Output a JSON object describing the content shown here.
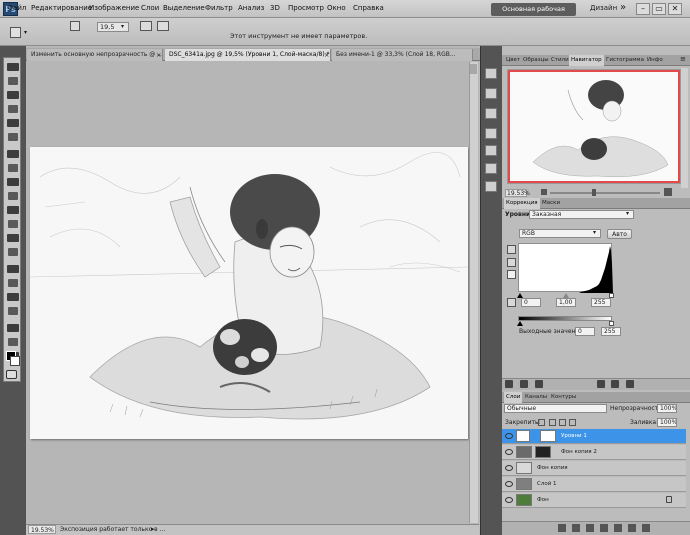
{
  "app": {
    "logo": "Ps"
  },
  "menu": [
    "Файл",
    "Редактирование",
    "Изображение",
    "Слои",
    "Выделение",
    "Фильтр",
    "Анализ",
    "3D",
    "Просмотр",
    "Окно",
    "Справка"
  ],
  "menubar_extras": {
    "zoom": "19,5",
    "zoom_arrow": "▾"
  },
  "workspace": {
    "active": "Основная рабочая среда",
    "design": "Дизайн",
    "more": "»"
  },
  "window_buttons": [
    "–",
    "▭",
    "✕"
  ],
  "options_bar": {
    "hint": "Этот инструмент не имеет параметров."
  },
  "doc_tabs": [
    {
      "label": "Изменить основную непрозрачность @ ...",
      "active": false
    },
    {
      "label": "DSC_6341a.jpg @ 19,5% (Уровни 1, Слой-маска/8) *",
      "active": true
    },
    {
      "label": "Без имени-1 @ 33,3% (Слой 18, RGB...",
      "active": false
    }
  ],
  "status": {
    "zoom": "19.53%",
    "text": "Экспозиция работает только в ...",
    "arrow": "▸"
  },
  "navigator": {
    "tabs": [
      "Цвет",
      "Образцы",
      "Стили",
      "Навигатор",
      "Гистограмма",
      "Инфо"
    ],
    "active_tab": "Навигатор",
    "zoom": "19.53%"
  },
  "corrections": {
    "tabs": [
      "Коррекция",
      "Маски"
    ],
    "levels_label": "Уровни",
    "preset": "Заказная",
    "channel": "RGB",
    "auto_button": "Авто",
    "input_black": "0",
    "input_gamma": "1,00",
    "input_white": "255",
    "output_label": "Выходные значения:",
    "output_black": "0",
    "output_white": "255"
  },
  "layers": {
    "tabs": [
      "Слои",
      "Каналы",
      "Контуры"
    ],
    "blend_mode": "Обычные",
    "opacity_label": "Непрозрачность:",
    "opacity": "100%",
    "lock_label": "Закрепить:",
    "fill_label": "Заливка:",
    "fill": "100%",
    "rows": [
      {
        "name": "Уровни 1",
        "selected": true
      },
      {
        "name": "Фон копия 2",
        "selected": false
      },
      {
        "name": "Фон копия",
        "selected": false
      },
      {
        "name": "Слой 1",
        "selected": false
      },
      {
        "name": "Фон",
        "selected": false
      }
    ]
  },
  "colors": {
    "selection": "#3d93e8",
    "nav_frame": "#e34b4b"
  }
}
